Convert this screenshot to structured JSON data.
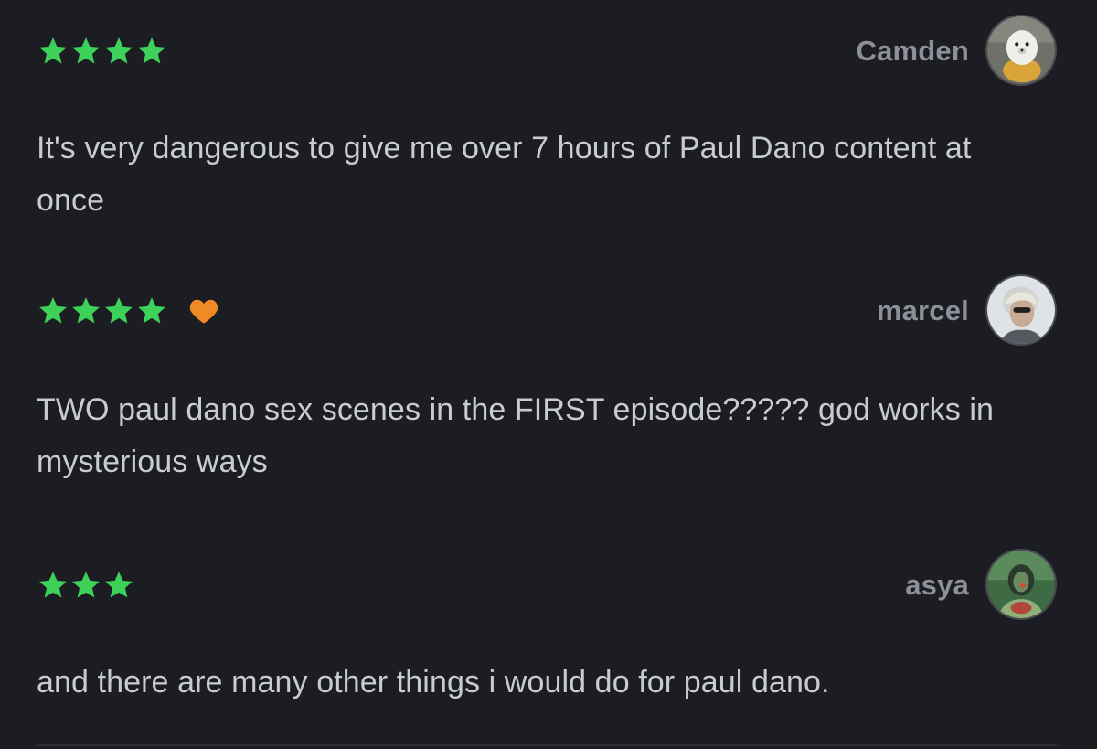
{
  "colors": {
    "background": "#1c1d22",
    "star": "#3ed15a",
    "heart": "#f08a24",
    "author": "#8e9099",
    "body_text": "#c9cbd3"
  },
  "reviews": [
    {
      "rating": 4,
      "liked": false,
      "author": "Camden",
      "avatar": "seal-avatar",
      "text": "It's very dangerous to give me over 7 hours of Paul Dano content at once"
    },
    {
      "rating": 4,
      "liked": true,
      "author": "marcel",
      "avatar": "person-sunglasses-avatar",
      "text": "TWO paul dano sex scenes in the FIRST episode????? god works in mysterious ways"
    },
    {
      "rating": 3,
      "liked": false,
      "author": "asya",
      "avatar": "person-green-avatar",
      "text": "and there are many other things i would do for paul dano."
    }
  ]
}
